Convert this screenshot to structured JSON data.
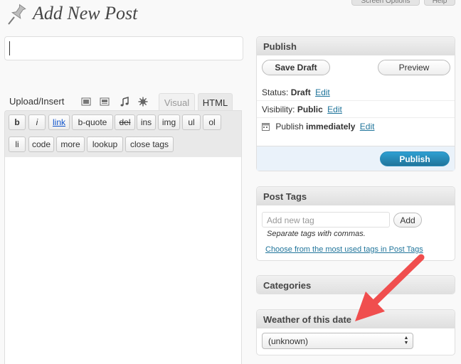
{
  "screen_tabs": {
    "screen_options": "Screen Options",
    "help": "Help"
  },
  "header": {
    "title": "Add New Post"
  },
  "editor": {
    "upload_label": "Upload/Insert",
    "media_icons": [
      "image-icon",
      "video-icon",
      "audio-icon",
      "media-icon"
    ],
    "tabs": {
      "visual": "Visual",
      "html": "HTML"
    },
    "quicktags": {
      "b": "b",
      "i": "i",
      "link": "link",
      "b_quote": "b-quote",
      "del": "del",
      "ins": "ins",
      "img": "img",
      "ul": "ul",
      "ol": "ol",
      "li": "li",
      "code": "code",
      "more": "more",
      "lookup": "lookup",
      "close_tags": "close tags"
    }
  },
  "publish": {
    "title": "Publish",
    "save_draft": "Save Draft",
    "preview": "Preview",
    "status_label": "Status:",
    "status_value": "Draft",
    "visibility_label": "Visibility:",
    "visibility_value": "Public",
    "schedule_prefix": "Publish",
    "schedule_value": "immediately",
    "edit": "Edit",
    "publish_button": "Publish"
  },
  "tags": {
    "title": "Post Tags",
    "placeholder": "Add new tag",
    "add_button": "Add",
    "hint": "Separate tags with commas.",
    "cloud_link": "Choose from the most used tags in Post Tags"
  },
  "categories": {
    "title": "Categories"
  },
  "weather": {
    "title": "Weather of this date",
    "selected": "(unknown)"
  },
  "colors": {
    "accent": "#21759b",
    "annotation_arrow": "#f04e4e",
    "background": "#f9f9f9"
  }
}
